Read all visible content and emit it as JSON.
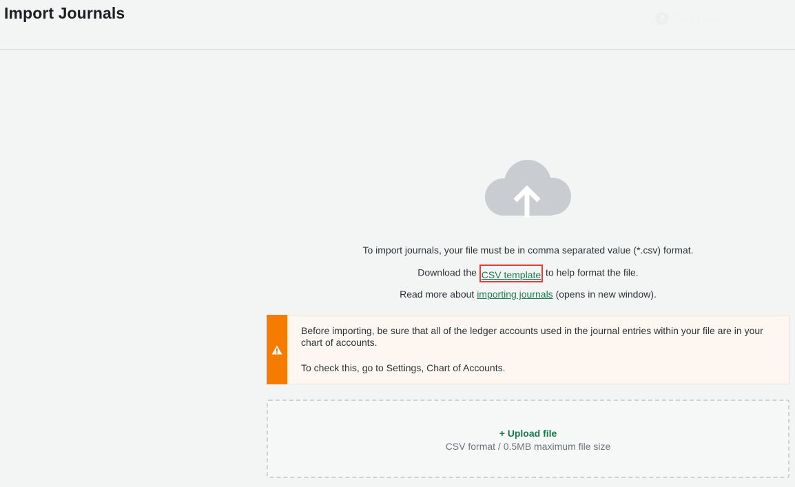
{
  "header": {
    "title": "Import Journals",
    "whats_new_label": "What's New",
    "help_glyph": "?"
  },
  "main": {
    "icon": "cloud-upload-icon",
    "line1": "To import journals, your file must be in comma separated value (*.csv) format.",
    "line2_before": "Download the ",
    "line2_link": "CSV template",
    "line2_after": " to help format the file.",
    "line3_before": "Read more about ",
    "line3_link": "importing journals",
    "line3_after": " (opens in new window)."
  },
  "warning": {
    "icon": "warning-triangle-icon",
    "text1": "Before importing, be sure that all of the ledger accounts used in the journal entries within your file are in your chart of accounts.",
    "text2": "To check this, go to Settings, Chart of Accounts."
  },
  "upload": {
    "label": "+ Upload file",
    "hint": "CSV format / 0.5MB maximum file size"
  },
  "colors": {
    "background": "#f3f5f5",
    "link_green": "#1c7a4c",
    "warning_orange": "#f57c00",
    "warning_bg": "#fef6f1",
    "highlight_red": "#e23b3b",
    "icon_gray": "#c9cdd1"
  }
}
